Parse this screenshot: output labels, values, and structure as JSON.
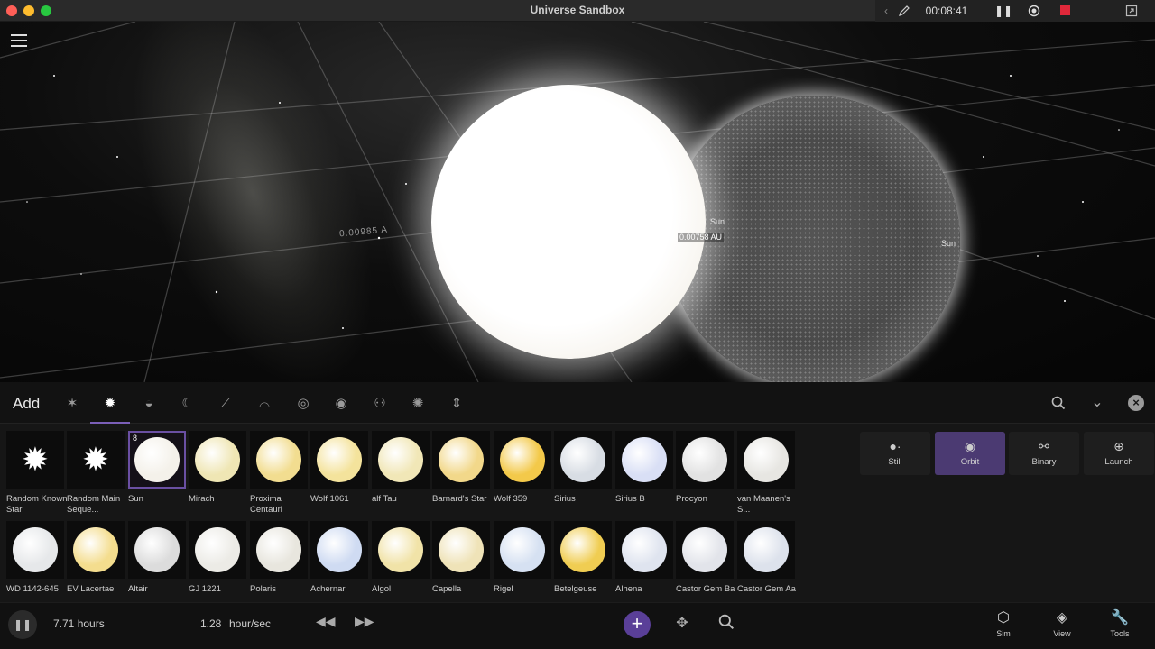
{
  "window": {
    "title": "Universe Sandbox",
    "timer": "00:08:41"
  },
  "scene": {
    "labels": {
      "sun_primary": "Sun",
      "distance": "0.00758 AU",
      "sun_secondary": "Sun",
      "ghost_distance": "0.00985 A"
    }
  },
  "add_panel": {
    "title": "Add",
    "categories": [
      {
        "name": "random",
        "icon": "sparkle-icon",
        "glyph": "✶"
      },
      {
        "name": "stars",
        "icon": "star-icon",
        "glyph": "✹",
        "active": true
      },
      {
        "name": "planets",
        "icon": "planet-icon",
        "glyph": "◒"
      },
      {
        "name": "moons",
        "icon": "moon-icon",
        "glyph": "☾"
      },
      {
        "name": "asteroids",
        "icon": "comet-icon",
        "glyph": "⟋"
      },
      {
        "name": "spacecraft",
        "icon": "ufo-icon",
        "glyph": "⌓"
      },
      {
        "name": "galaxies",
        "icon": "spiral-icon",
        "glyph": "◎"
      },
      {
        "name": "black-holes",
        "icon": "eye-icon",
        "glyph": "◉"
      },
      {
        "name": "people",
        "icon": "people-icon",
        "glyph": "⚇"
      },
      {
        "name": "lights",
        "icon": "light-icon",
        "glyph": "✺"
      },
      {
        "name": "other",
        "icon": "anchor-icon",
        "glyph": "⇕"
      }
    ],
    "tiles_row1": [
      {
        "label": "Random Known Star",
        "type": "glyph"
      },
      {
        "label": "Random Main Seque...",
        "type": "glyph"
      },
      {
        "label": "Sun",
        "type": "ball",
        "color": "#f4f1ea",
        "selected": true,
        "badge": "8"
      },
      {
        "label": "Mirach",
        "type": "ball",
        "color": "#efe6b4"
      },
      {
        "label": "Proxima Centauri",
        "type": "ball",
        "color": "#f2dd90"
      },
      {
        "label": "Wolf 1061",
        "type": "ball",
        "color": "#f4e39c"
      },
      {
        "label": "alf Tau",
        "type": "ball",
        "color": "#f1e7b7"
      },
      {
        "label": "Barnard's Star",
        "type": "ball",
        "color": "#f2d88a"
      },
      {
        "label": "Wolf 359",
        "type": "ball",
        "color": "#f3c94a"
      },
      {
        "label": "Sirius",
        "type": "ball",
        "color": "#d8dde4"
      },
      {
        "label": "Sirius B",
        "type": "ball",
        "color": "#d9dff5"
      },
      {
        "label": "Procyon",
        "type": "ball",
        "color": "#e2e2e2"
      },
      {
        "label": "van Maanen's S...",
        "type": "ball",
        "color": "#e7e6e2"
      }
    ],
    "tiles_row2": [
      {
        "label": "WD 1142-645",
        "type": "ball",
        "color": "#e6e8ea"
      },
      {
        "label": "EV Lacertae",
        "type": "ball",
        "color": "#f4dd8e"
      },
      {
        "label": "Altair",
        "type": "ball",
        "color": "#dcdcdc"
      },
      {
        "label": "GJ 1221",
        "type": "ball",
        "color": "#ecebe6"
      },
      {
        "label": "Polaris",
        "type": "ball",
        "color": "#e8e6de"
      },
      {
        "label": "Achernar",
        "type": "ball",
        "color": "#cfdbf2"
      },
      {
        "label": "Algol",
        "type": "ball",
        "color": "#f1e3a8"
      },
      {
        "label": "Capella",
        "type": "ball",
        "color": "#efe3b8"
      },
      {
        "label": "Rigel",
        "type": "ball",
        "color": "#d6e1f2"
      },
      {
        "label": "Betelgeuse",
        "type": "ball",
        "color": "#f0cd52"
      },
      {
        "label": "Alhena",
        "type": "ball",
        "color": "#dfe4ef"
      },
      {
        "label": "Castor Gem Ba",
        "type": "ball",
        "color": "#e2e4ea"
      },
      {
        "label": "Castor Gem Aa",
        "type": "ball",
        "color": "#dde2ec"
      }
    ],
    "modes": [
      {
        "label": "Still",
        "icon": "dots-icon",
        "glyph": "●·"
      },
      {
        "label": "Orbit",
        "icon": "orbit-icon",
        "glyph": "◉",
        "active": true
      },
      {
        "label": "Binary",
        "icon": "binary-icon",
        "glyph": "⚯"
      },
      {
        "label": "Launch",
        "icon": "launch-icon",
        "glyph": "⊕"
      }
    ]
  },
  "bottom_bar": {
    "elapsed": "7.71 hours",
    "rate_value": "1.28",
    "rate_unit": "hour/sec",
    "nav": [
      {
        "label": "Sim",
        "icon": "cube-icon",
        "glyph": "⬡"
      },
      {
        "label": "View",
        "icon": "layers-icon",
        "glyph": "◈"
      },
      {
        "label": "Tools",
        "icon": "wrench-icon",
        "glyph": "🔧"
      }
    ]
  },
  "colors": {
    "accent": "#5a3f98",
    "selected_border": "#6a4fa3",
    "active_mode": "#4b3a72",
    "record": "#e0283a"
  }
}
